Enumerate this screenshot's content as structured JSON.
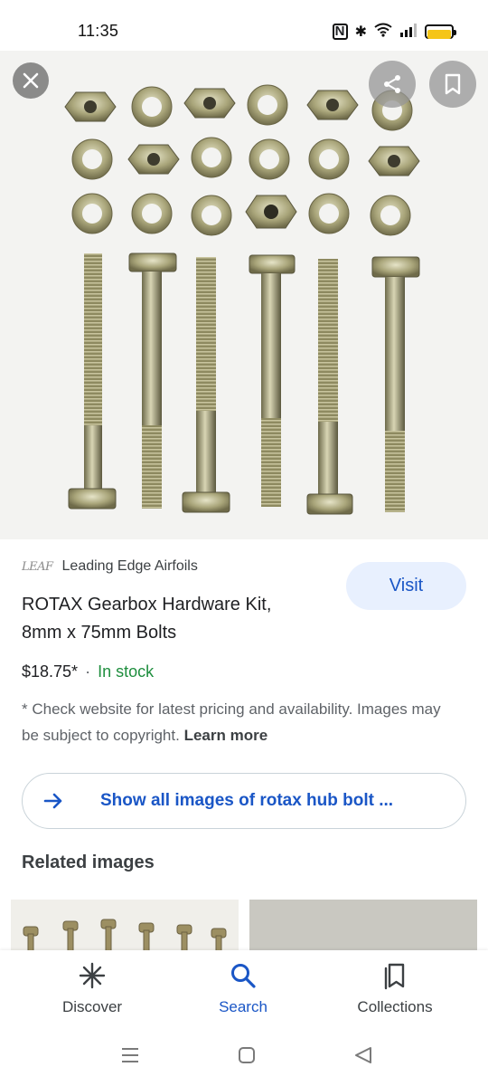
{
  "status": {
    "time": "11:35",
    "icons": [
      "nfc-icon",
      "bluetooth-icon",
      "wifi-icon",
      "signal-icon",
      "battery-icon"
    ],
    "battery_color": "#f5c518"
  },
  "hero": {
    "close_icon": "close-icon",
    "share_icon": "share-icon",
    "bookmark_icon": "bookmark-icon"
  },
  "result": {
    "source_logo": "LEAF",
    "source_name": "Leading Edge Airfoils",
    "visit_label": "Visit",
    "title_line1": "ROTAX Gearbox Hardware Kit,",
    "title_line2": "8mm x 75mm Bolts",
    "price": "$18.75*",
    "separator": "·",
    "stock": "In stock",
    "note": "* Check website for latest pricing and availability. Images may be subject to copyright.",
    "learn_more": "Learn more"
  },
  "show_all": {
    "label": "Show all images of rotax hub bolt ..."
  },
  "related": {
    "title": "Related images"
  },
  "bottom_nav": {
    "discover": "Discover",
    "search": "Search",
    "collections": "Collections"
  },
  "colors": {
    "accent": "#1a56c6",
    "in_stock": "#1e8e3e",
    "visit_bg": "#e8f0fe"
  }
}
